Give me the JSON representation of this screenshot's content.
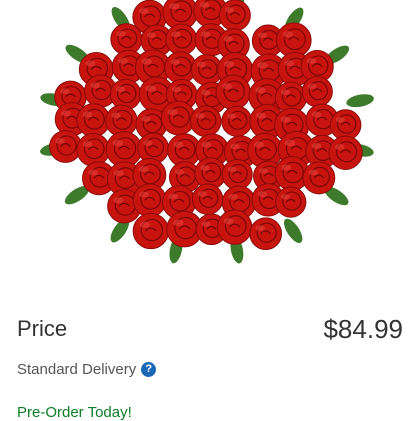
{
  "product": {
    "image_icon": "red-roses-bouquet-image",
    "rose_color": "#c8140f",
    "leaf_color": "#3d7a2c"
  },
  "pricing": {
    "label": "Price",
    "value": "$84.99"
  },
  "delivery": {
    "label": "Standard Delivery",
    "help_icon": "question-circle-icon",
    "help_glyph": "?",
    "accent_color": "#1a67b5"
  },
  "cta": {
    "label": "Pre-Order Today!",
    "color": "#0a7d25"
  }
}
